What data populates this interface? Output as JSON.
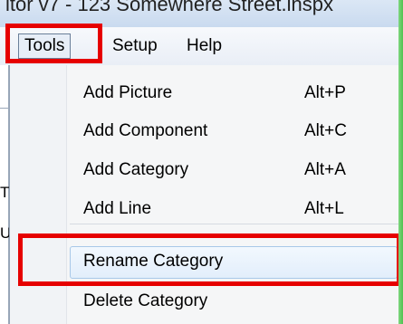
{
  "window": {
    "title_fragment": "itor v7 - 123 Somewhere Street.inspx"
  },
  "menubar": {
    "items": [
      {
        "label": "Tools"
      },
      {
        "label": "Setup"
      },
      {
        "label": "Help"
      }
    ]
  },
  "gutter": {
    "chars": [
      "T",
      "U"
    ]
  },
  "tools_menu": {
    "items": [
      {
        "label": "Add Picture",
        "shortcut": "Alt+P"
      },
      {
        "label": "Add Component",
        "shortcut": "Alt+C"
      },
      {
        "label": "Add Category",
        "shortcut": "Alt+A"
      },
      {
        "label": "Add Line",
        "shortcut": "Alt+L"
      },
      {
        "label": "Rename Category",
        "shortcut": ""
      },
      {
        "label": "Delete Category",
        "shortcut": ""
      }
    ],
    "highlighted_item": "Rename Category"
  },
  "annotation": {
    "color": "#e60000"
  }
}
